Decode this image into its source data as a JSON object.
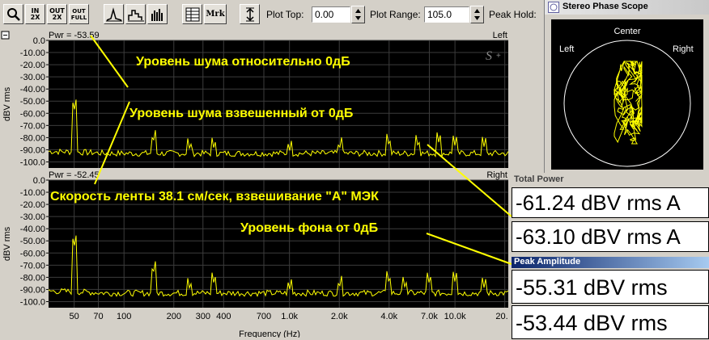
{
  "toolbar": {
    "buttons": [
      {
        "name": "zoom-button",
        "label": "",
        "icon": "magnifier-icon"
      },
      {
        "name": "zoom-in-2x-button",
        "label": "IN 2X"
      },
      {
        "name": "zoom-out-2x-button",
        "label": "OUT 2X"
      },
      {
        "name": "zoom-out-full-button",
        "label": "OUT FULL"
      },
      {
        "name": "line-graph-button",
        "label": "",
        "icon": "line-spectrum-icon"
      },
      {
        "name": "step-graph-button",
        "label": "",
        "icon": "step-spectrum-icon"
      },
      {
        "name": "bar-graph-button",
        "label": "",
        "icon": "bar-spectrum-icon"
      },
      {
        "name": "table-button",
        "label": "",
        "icon": "table-icon"
      },
      {
        "name": "marker-button",
        "label": "Mrk"
      },
      {
        "name": "vertical-range-button",
        "label": "",
        "icon": "vertical-range-icon"
      }
    ],
    "plot_top_label": "Plot Top:",
    "plot_top_value": "0.00",
    "plot_range_label": "Plot Range:",
    "plot_range_value": "105.0",
    "peak_hold_label": "Peak Hold:"
  },
  "plots": {
    "y_label": "dBV rms",
    "x_label": "Frequency (Hz)",
    "x_ticks": [
      "50",
      "70",
      "100",
      "200",
      "300",
      "400",
      "700",
      "1.0k",
      "2.0k",
      "4.0k",
      "7.0k",
      "10.0k",
      "20."
    ],
    "y_ticks": [
      "0.0",
      "-10.00",
      "-20.00",
      "-30.00",
      "-40.00",
      "-50.00",
      "-60.00",
      "-70.00",
      "-80.00",
      "-90.00",
      "-100.0"
    ],
    "top": {
      "pwr": "Pwr = -53.59",
      "channel": "Left",
      "logo": "S"
    },
    "bottom": {
      "pwr": "Pwr = -52.45",
      "channel": "Right"
    },
    "colors": {
      "trace": "#ffff00",
      "background": "#000000",
      "grid": "#3c3c3c"
    }
  },
  "chart_data": {
    "type": "line",
    "x_scale": "log",
    "xlim": [
      35,
      21000
    ],
    "ylim": [
      -105,
      0
    ],
    "series": [
      {
        "name": "Left",
        "floor": -93,
        "peaks": [
          [
            50,
            -58
          ],
          [
            150,
            -85
          ],
          [
            250,
            -91
          ],
          [
            350,
            -90
          ],
          [
            1000,
            -92
          ],
          [
            2000,
            -91
          ],
          [
            4000,
            -88
          ],
          [
            6000,
            -89
          ],
          [
            8000,
            -85
          ],
          [
            10000,
            -87
          ],
          [
            15000,
            -88
          ]
        ]
      },
      {
        "name": "Right",
        "floor": -93,
        "peaks": [
          [
            50,
            -55
          ],
          [
            150,
            -78
          ],
          [
            250,
            -91
          ],
          [
            350,
            -86
          ],
          [
            1000,
            -91
          ],
          [
            2000,
            -90
          ],
          [
            4000,
            -86
          ],
          [
            5000,
            -90
          ],
          [
            7000,
            -86
          ],
          [
            10000,
            -84
          ],
          [
            15000,
            -89
          ]
        ]
      }
    ]
  },
  "annotations": {
    "noise_rel": "Уровень шума относительно 0дБ",
    "noise_weighted": "Уровень шума взвешенный от 0дБ",
    "tape_speed": "Скорость ленты 38.1 см/сек, взвешивание  \"А\" МЭК",
    "hum": "Уровень фона от 0дБ"
  },
  "scope": {
    "title": "Stereo Phase Scope",
    "center": "Center",
    "left": "Left",
    "right": "Right",
    "colors": {
      "trace": "#ffff00",
      "circle": "#ffffff"
    }
  },
  "total_power": {
    "title": "Total Power",
    "values": [
      "-61.24 dBV rms A",
      "-63.10 dBV rms A"
    ]
  },
  "peak_amplitude": {
    "title": "Peak Amplitude",
    "values": [
      "-55.31 dBV rms",
      "-53.44 dBV rms"
    ]
  }
}
